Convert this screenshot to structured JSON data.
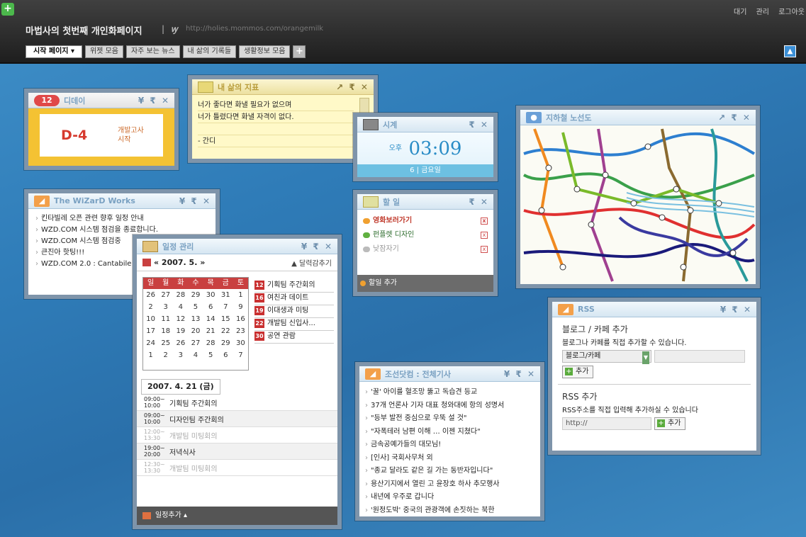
{
  "header": {
    "site_title": "마법사의 첫번째 개인화페이지",
    "separator": "|",
    "logo": "ꝡ",
    "url": "http://holies.mommos.com/orangemilk",
    "top_links": [
      "대기",
      "관리",
      "로그아웃"
    ]
  },
  "tabs": [
    {
      "label": "시작 페이지 ▾"
    },
    {
      "label": "위젯 모음"
    },
    {
      "label": "자주 보는 뉴스"
    },
    {
      "label": "내 삶의 기록들"
    },
    {
      "label": "생활정보 모음"
    }
  ],
  "widgets": {
    "dday": {
      "badge": "12",
      "title": "디데이",
      "dday": "D-4",
      "event_line1": "개발고사",
      "event_line2": "시작"
    },
    "note": {
      "title": "내 삶의 지표",
      "lines": [
        "너가 좋다면 화낼 필요가 없으며",
        "너가 틀렸다면 화낼 자격이 없다.",
        "",
        "- 간디"
      ]
    },
    "clock": {
      "title": "시계",
      "ampm": "오후",
      "time": "03:09",
      "date": "6 | 금요일"
    },
    "subway": {
      "title": "지하철 노선도"
    },
    "wizard": {
      "title": "The WiZarD Works",
      "items": [
        "킨타빌레 오픈 관련 향후 일정 안내",
        "WZD.COM 시스템 점검을 종료합니다.",
        "WZD.COM 시스템 점검중",
        "큰진아 핫팅!!!",
        "WZD.COM 2.0 : Cantabile"
      ]
    },
    "todo": {
      "title": "할 일",
      "items": [
        "영화보러가기",
        "펀플렛 디자인",
        "낮잠자기"
      ],
      "add": "할일 추가"
    },
    "schedule": {
      "title": "일정 관리",
      "month": "« 2007. 5. »",
      "add_calendar": "▲ 달력감추기",
      "dow": [
        "일",
        "월",
        "화",
        "수",
        "목",
        "금",
        "토"
      ],
      "weeks": [
        [
          "26",
          "27",
          "28",
          "29",
          "30",
          "31",
          "1"
        ],
        [
          "2",
          "3",
          "4",
          "5",
          "6",
          "7",
          "9"
        ],
        [
          "10",
          "11",
          "12",
          "13",
          "14",
          "15",
          "16"
        ],
        [
          "17",
          "18",
          "19",
          "20",
          "21",
          "22",
          "23"
        ],
        [
          "24",
          "25",
          "26",
          "27",
          "28",
          "29",
          "30"
        ],
        [
          "1",
          "2",
          "3",
          "4",
          "5",
          "6",
          "7"
        ]
      ],
      "events": [
        {
          "day": "12",
          "name": "기획팀 주간회의"
        },
        {
          "day": "16",
          "name": "여친과 데이트"
        },
        {
          "day": "19",
          "name": "이대생과 미팅"
        },
        {
          "day": "22",
          "name": "개발팀 신입사..."
        },
        {
          "day": "30",
          "name": "공연 관람"
        }
      ],
      "day_title": "2007. 4. 21 (금)",
      "slots": [
        {
          "time": "09:00~ 10:00",
          "name": "기획팀 주간회의"
        },
        {
          "time": "09:00~ 10:00",
          "name": "디자인팀 주간회의"
        },
        {
          "time": "12:00~ 13:30",
          "name": "개발팀 미팅회의"
        },
        {
          "time": "19:00~ 20:00",
          "name": "저녁식사"
        },
        {
          "time": "12:30~ 13:30",
          "name": "개발팀 미팅회의"
        }
      ],
      "add": "일정추가 ▴"
    },
    "chosun": {
      "title": "조선닷컴 : 전체기사",
      "items": [
        "'꿀' 아이를 혈조망 뚫고 독습견 등교",
        "37개 언론사 기자 대표 청와대에 항의 성명서",
        "\"등부 발전 중심으로 우뚝 설 것\"",
        "\"자폭테러 남편 이해 … 이젠 지쳤다\"",
        "금속공예가들의 대모님!",
        "[인사] 국회사무처 외",
        "\"종교 달라도 같은 길 가는 동반자입니다\"",
        "용산기지에서 열린 고 윤장호 하사 추모행사",
        "내년에 우주로 갑니다",
        "'원정도박' 중국의 관광객에 손짓하는 북한"
      ]
    },
    "rss": {
      "title": "RSS",
      "blog_title": "블로그 / 카페 추가",
      "blog_desc": "블로그나 카페를 직접 추가할 수 있습니다.",
      "blog_select": "블로그/카페",
      "add_label": "추가",
      "rss_title": "RSS 추가",
      "rss_desc": "RSS주소를 직접 입력해 추가하실 수 있습니다",
      "rss_placeholder": "http://"
    }
  }
}
